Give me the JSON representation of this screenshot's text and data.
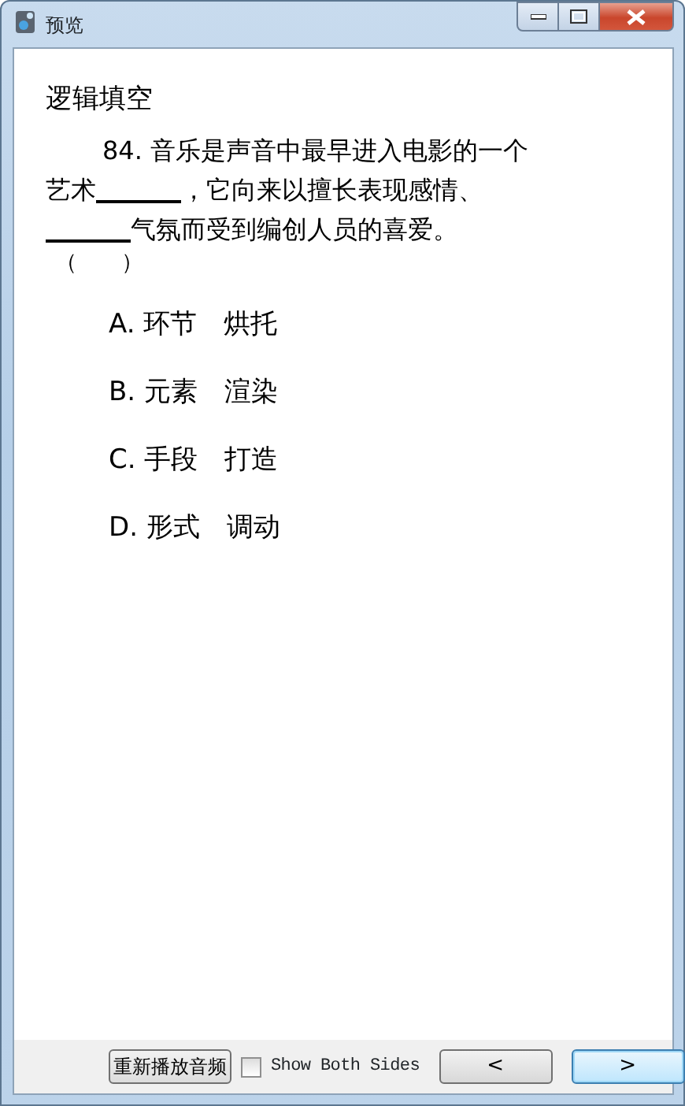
{
  "window": {
    "title": "预览"
  },
  "section_title": "逻辑填空",
  "question_lines": [
    [
      {
        "kind": "text",
        "text": "84. 音乐是声音中最早进入电影的一个"
      }
    ],
    [
      {
        "kind": "text",
        "text": "艺术"
      },
      {
        "kind": "blank"
      },
      {
        "kind": "text",
        "text": "，它向来以擅长表现感情、"
      }
    ],
    [
      {
        "kind": "blank"
      },
      {
        "kind": "text",
        "text": "气氛而受到编创人员的喜爱。"
      }
    ]
  ],
  "answer_paren": "（　　）",
  "options": [
    {
      "letter": "A.",
      "text": "环节　烘托"
    },
    {
      "letter": "B.",
      "text": "元素　渲染"
    },
    {
      "letter": "C.",
      "text": "手段　打造"
    },
    {
      "letter": "D.",
      "text": "形式　调动"
    }
  ],
  "footer": {
    "replay_button": "重新播放音频",
    "show_both_sides": {
      "label": "Show Both Sides",
      "checked": false
    },
    "prev_button": "<",
    "next_button": ">"
  }
}
